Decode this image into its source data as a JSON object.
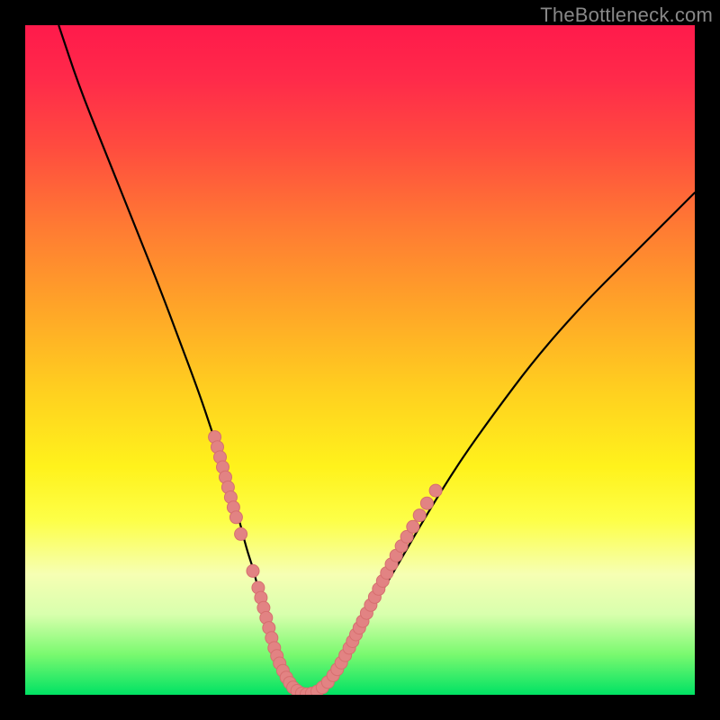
{
  "watermark": "TheBottleneck.com",
  "colors": {
    "background": "#000000",
    "curve": "#000000",
    "marker_fill": "#e28383",
    "marker_stroke": "#d66f6f",
    "gradient_top": "#ff1a4b",
    "gradient_bottom": "#00e264"
  },
  "chart_data": {
    "type": "line",
    "title": "",
    "xlabel": "",
    "ylabel": "",
    "xlim": [
      0,
      100
    ],
    "ylim": [
      0,
      100
    ],
    "grid": false,
    "series": [
      {
        "name": "curve",
        "x": [
          5,
          8,
          12,
          16,
          20,
          23,
          26,
          28,
          30,
          31,
          32,
          33,
          34,
          35,
          36,
          37,
          38,
          39,
          40,
          42,
          44,
          46,
          48,
          50,
          53,
          56,
          60,
          65,
          70,
          76,
          83,
          90,
          98,
          100
        ],
        "y": [
          100,
          91,
          81,
          71,
          61,
          53,
          45,
          39,
          33,
          29,
          26,
          22,
          19,
          15,
          11,
          8,
          5,
          3,
          1,
          0,
          1,
          3,
          6,
          10,
          15,
          20,
          27,
          35,
          42,
          50,
          58,
          65,
          73,
          75
        ]
      }
    ],
    "markers": [
      {
        "x": 28.3,
        "y": 38.5
      },
      {
        "x": 28.7,
        "y": 37.0
      },
      {
        "x": 29.1,
        "y": 35.5
      },
      {
        "x": 29.5,
        "y": 34.0
      },
      {
        "x": 29.9,
        "y": 32.5
      },
      {
        "x": 30.3,
        "y": 31.0
      },
      {
        "x": 30.7,
        "y": 29.5
      },
      {
        "x": 31.1,
        "y": 28.0
      },
      {
        "x": 31.5,
        "y": 26.5
      },
      {
        "x": 32.2,
        "y": 24.0
      },
      {
        "x": 34.0,
        "y": 18.5
      },
      {
        "x": 34.8,
        "y": 16.0
      },
      {
        "x": 35.2,
        "y": 14.5
      },
      {
        "x": 35.6,
        "y": 13.0
      },
      {
        "x": 36.0,
        "y": 11.5
      },
      {
        "x": 36.4,
        "y": 10.0
      },
      {
        "x": 36.8,
        "y": 8.5
      },
      {
        "x": 37.2,
        "y": 7.0
      },
      {
        "x": 37.6,
        "y": 5.8
      },
      {
        "x": 38.0,
        "y": 4.7
      },
      {
        "x": 38.5,
        "y": 3.6
      },
      {
        "x": 39.0,
        "y": 2.6
      },
      {
        "x": 39.5,
        "y": 1.8
      },
      {
        "x": 40.0,
        "y": 1.1
      },
      {
        "x": 40.6,
        "y": 0.6
      },
      {
        "x": 41.3,
        "y": 0.2
      },
      {
        "x": 42.0,
        "y": 0.1
      },
      {
        "x": 42.8,
        "y": 0.2
      },
      {
        "x": 43.6,
        "y": 0.5
      },
      {
        "x": 44.4,
        "y": 1.1
      },
      {
        "x": 45.2,
        "y": 1.9
      },
      {
        "x": 46.0,
        "y": 2.9
      },
      {
        "x": 46.6,
        "y": 3.8
      },
      {
        "x": 47.2,
        "y": 4.8
      },
      {
        "x": 47.8,
        "y": 5.9
      },
      {
        "x": 48.4,
        "y": 7.0
      },
      {
        "x": 48.9,
        "y": 8.0
      },
      {
        "x": 49.4,
        "y": 9.0
      },
      {
        "x": 49.9,
        "y": 10.0
      },
      {
        "x": 50.4,
        "y": 11.0
      },
      {
        "x": 51.0,
        "y": 12.2
      },
      {
        "x": 51.6,
        "y": 13.4
      },
      {
        "x": 52.2,
        "y": 14.6
      },
      {
        "x": 52.8,
        "y": 15.8
      },
      {
        "x": 53.4,
        "y": 17.0
      },
      {
        "x": 54.0,
        "y": 18.2
      },
      {
        "x": 54.7,
        "y": 19.5
      },
      {
        "x": 55.4,
        "y": 20.8
      },
      {
        "x": 56.2,
        "y": 22.2
      },
      {
        "x": 57.0,
        "y": 23.6
      },
      {
        "x": 57.9,
        "y": 25.1
      },
      {
        "x": 58.9,
        "y": 26.8
      },
      {
        "x": 60.0,
        "y": 28.6
      },
      {
        "x": 61.3,
        "y": 30.5
      }
    ]
  }
}
